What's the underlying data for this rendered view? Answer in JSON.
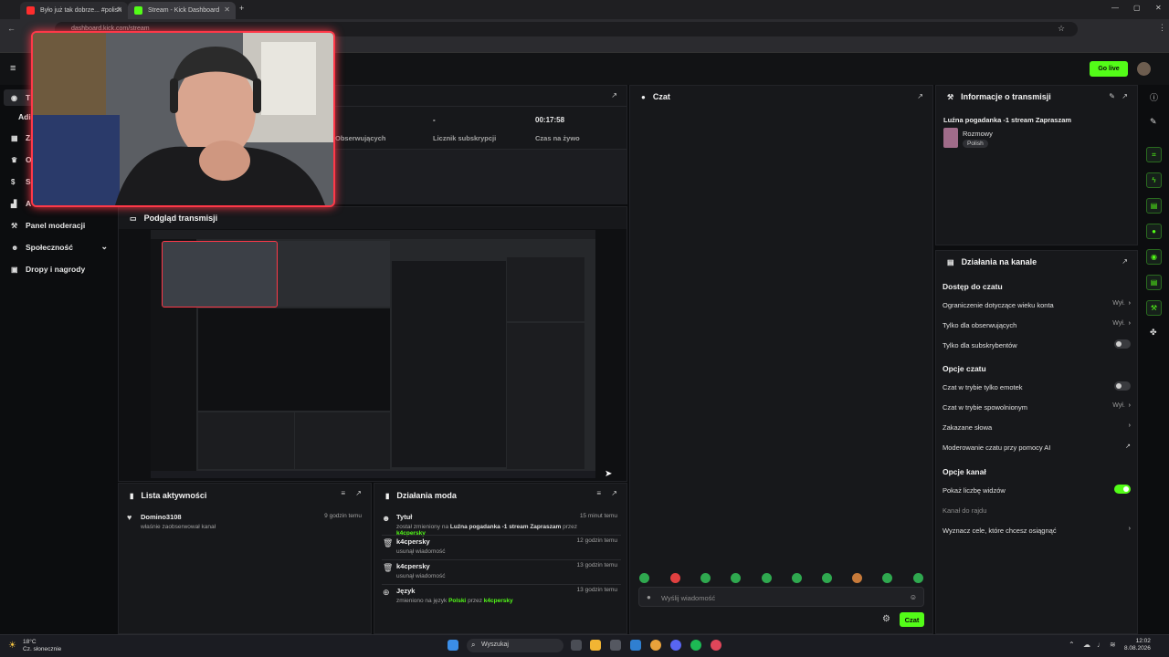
{
  "browser": {
    "tabs": [
      {
        "title": "Było już tak dobrze... #polish",
        "favicon_color": "#ff2d2d"
      },
      {
        "title": "Stream - Kick Dashboard",
        "favicon_color": "#53fc18"
      }
    ],
    "url": "dashboard.kick.com/stream"
  },
  "header": {
    "go_live_label": "Go live",
    "menu_icon": "hamburger-icon"
  },
  "sidebar": {
    "items": [
      {
        "label": "T",
        "icon": "broadcast-icon"
      },
      {
        "label": "Adi",
        "icon": ""
      },
      {
        "label": "Za",
        "icon": "grid-icon"
      },
      {
        "label": "O",
        "icon": "trophy-icon"
      },
      {
        "label": "Si",
        "icon": "dollar-icon"
      },
      {
        "label": "A",
        "icon": "chart-icon"
      },
      {
        "label": "Panel moderacji",
        "icon": "wrench-icon"
      },
      {
        "label": "Społeczność",
        "icon": "users-icon"
      },
      {
        "label": "Dropy i nagrody",
        "icon": "gift-icon"
      }
    ]
  },
  "stats": {
    "followers_label": "Obserwujących",
    "subs_value": "-",
    "subs_label": "Licznik subskrypcji",
    "live_value": "00:17:58",
    "live_label": "Czas na żywo"
  },
  "preview": {
    "title": "Podgląd transmisji"
  },
  "activity": {
    "title": "Lista aktywności",
    "items": [
      {
        "name": "Domino3108",
        "text": "właśnie zaobserwował kanał",
        "time": "9 godzin temu"
      }
    ]
  },
  "mod_actions": {
    "title": "Działania moda",
    "items": [
      {
        "icon": "users-icon",
        "name": "Tytuł",
        "pre": "został zmieniony na",
        "value": "Luźna pogadanka -1 stream Zapraszam",
        "mid": "przez",
        "user": "k4cpersky",
        "time": "15 minut temu"
      },
      {
        "icon": "trash-icon",
        "name": "k4cpersky",
        "pre": "usunął wiadomość",
        "value": "",
        "mid": "",
        "user": "",
        "time": "12 godzin temu"
      },
      {
        "icon": "trash-icon",
        "name": "k4cpersky",
        "pre": "usunął wiadomość",
        "value": "",
        "mid": "",
        "user": "",
        "time": "13 godzin temu"
      },
      {
        "icon": "globe-icon",
        "name": "Język",
        "pre": "zmieniono na język",
        "value": "Polski",
        "mid": "przez",
        "user": "k4cpersky",
        "time": "13 godzin temu"
      }
    ]
  },
  "chat": {
    "title": "Czat",
    "placeholder": "Wyślij wiadomość",
    "send_label": "Czat"
  },
  "stream_info": {
    "title": "Informacje o transmisji",
    "stream_title": "Luźna pogadanka -1 stream Zapraszam",
    "category": "Rozmowy",
    "tag": "Polish"
  },
  "channel_actions": {
    "title": "Działania na kanale",
    "sections": [
      {
        "heading": "Dostęp do czatu",
        "rows": [
          {
            "label": "Ograniczenie dotyczące wieku konta",
            "value": "Wył.",
            "control": "chevron"
          },
          {
            "label": "Tylko dla obserwujących",
            "value": "Wył.",
            "control": "chevron"
          },
          {
            "label": "Tylko dla subskrybentów",
            "value": "",
            "control": "toggle-off"
          }
        ]
      },
      {
        "heading": "Opcje czatu",
        "rows": [
          {
            "label": "Czat w trybie tylko emotek",
            "value": "",
            "control": "toggle-off"
          },
          {
            "label": "Czat w trybie spowolnionym",
            "value": "Wył.",
            "control": "chevron"
          },
          {
            "label": "Zakazane słowa",
            "value": "",
            "control": "chevron"
          },
          {
            "label": "Moderowanie czatu przy pomocy AI",
            "value": "",
            "control": "external"
          }
        ]
      },
      {
        "heading": "Opcje kanał",
        "rows": [
          {
            "label": "Pokaż liczbę widzów",
            "value": "",
            "control": "toggle-on"
          },
          {
            "label": "Kanał do rajdu",
            "value": "",
            "control": "none"
          },
          {
            "label": "Wyznacz cele, które chcesz osiągnąć",
            "value": "",
            "control": "chevron"
          }
        ]
      }
    ]
  },
  "taskbar": {
    "weather_temp": "18°C",
    "weather_desc": "Cz. słonecznie",
    "search_placeholder": "Wyszukaj",
    "time": "12:02",
    "date": "8.08.2026"
  }
}
